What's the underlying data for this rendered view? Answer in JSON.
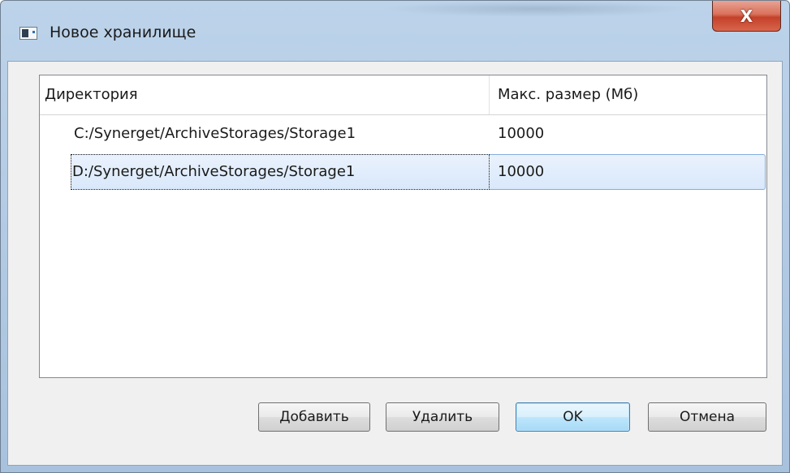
{
  "window": {
    "title": "Новое хранилище",
    "close_glyph": "X",
    "icon": "window-app-icon"
  },
  "table": {
    "columns": [
      "Директория",
      "Макс. размер (Мб)"
    ],
    "rows": [
      {
        "directory": "C:/Synerget/ArchiveStorages/Storage1",
        "max_size": "10000",
        "selected": false
      },
      {
        "directory": "D:/Synerget/ArchiveStorages/Storage1",
        "max_size": "10000",
        "selected": true
      }
    ]
  },
  "buttons": {
    "add": "Добавить",
    "delete": "Удалить",
    "ok": "OK",
    "cancel": "Отмена"
  },
  "colors": {
    "selection": "#d9e8fb",
    "ok_default": "#bee6fd",
    "close_button": "#c4402a"
  }
}
